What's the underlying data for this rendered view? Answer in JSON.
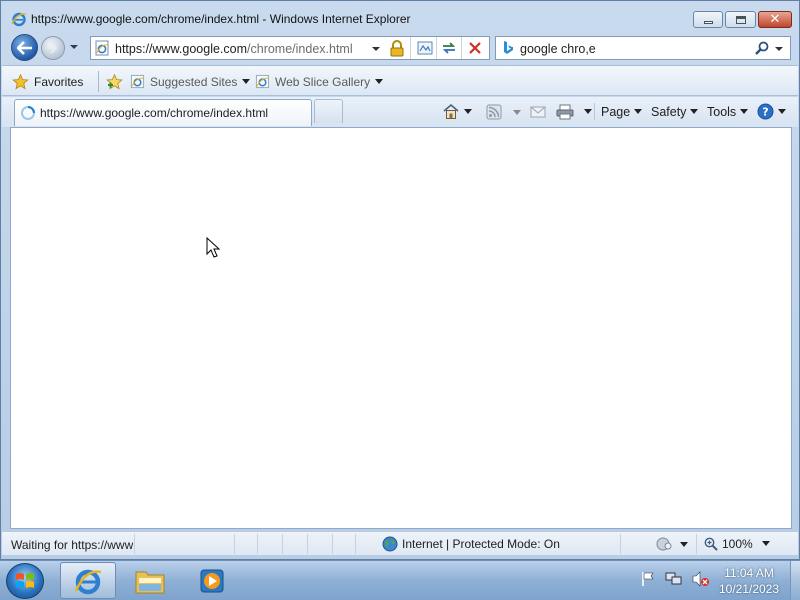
{
  "window": {
    "title": "https://www.google.com/chrome/index.html - Windows Internet Explorer",
    "minimize_icon": "minimize-icon",
    "maximize_icon": "maximize-icon",
    "close_icon": "close-icon"
  },
  "navigation": {
    "back_icon": "back-arrow-icon",
    "forward_icon": "forward-arrow-icon",
    "address": {
      "host": "https://www.google.com",
      "path": "/chrome/index.html"
    },
    "lock_icon": "padlock-icon",
    "compat_icon": "compatibility-view-icon",
    "refresh_icon": "refresh-icon",
    "stop_icon": "stop-icon",
    "search": {
      "provider_icon": "bing-icon",
      "value": "google chro,e"
    }
  },
  "favorites_bar": {
    "favorites_label": "Favorites",
    "items": [
      {
        "label": "Suggested Sites"
      },
      {
        "label": "Web Slice Gallery"
      }
    ]
  },
  "tabs": [
    {
      "label": "https://www.google.com/chrome/index.html"
    }
  ],
  "command_bar": {
    "page_label": "Page",
    "safety_label": "Safety",
    "tools_label": "Tools"
  },
  "status_bar": {
    "text": "Waiting for https://www",
    "zone": "Internet | Protected Mode: On",
    "zoom": "100%"
  },
  "taskbar": {
    "apps": [
      "internet-explorer",
      "windows-explorer",
      "media-player"
    ],
    "clock_time": "11:04 AM",
    "clock_date": "10/21/2023"
  },
  "colors": {
    "frame": "#b7cde6",
    "accent": "#1f5aa8",
    "close": "#c0452b"
  }
}
